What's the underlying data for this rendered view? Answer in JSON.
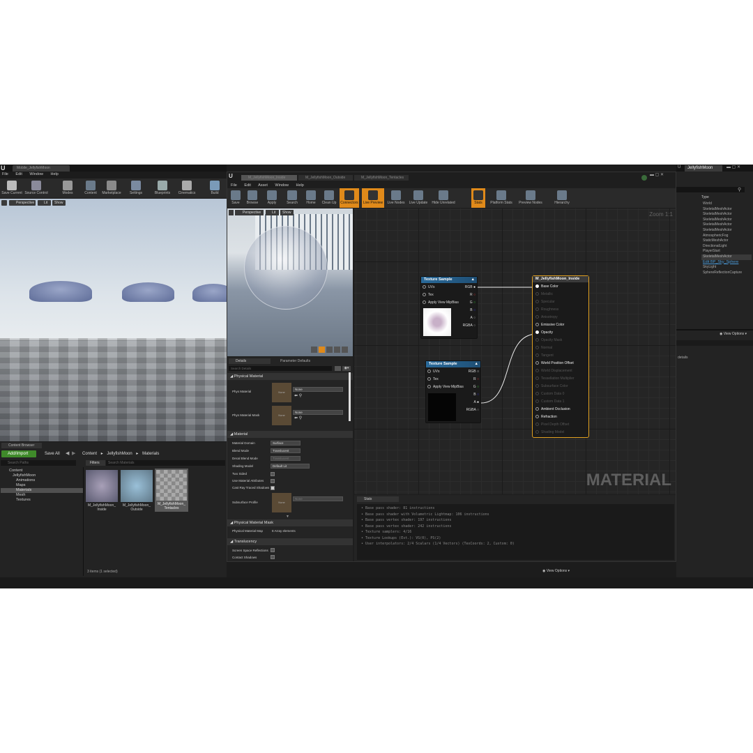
{
  "main_editor": {
    "tab_title": "Mobile_JellyfishMoon",
    "menu": [
      "File",
      "Edit",
      "Window",
      "Help"
    ],
    "toolbar": [
      "Save Current",
      "Source Control",
      "Modes",
      "Content",
      "Marketplace",
      "Settings",
      "Blueprints",
      "Cinematics",
      "Build"
    ],
    "viewport": {
      "perspective": "Perspective",
      "lit": "Lit",
      "show": "Show"
    }
  },
  "content_browser": {
    "tab": "Content Browser",
    "add_import": "Add/Import",
    "save_all": "Save All",
    "breadcrumb": [
      "Content",
      "JellyfishMoon",
      "Materials"
    ],
    "search_paths": "Search Paths",
    "filters": "Filters",
    "search_materials": "Search Materials",
    "tree": [
      {
        "label": "Content",
        "level": 0
      },
      {
        "label": "JellyfishMoon",
        "level": 1
      },
      {
        "label": "Animations",
        "level": 2
      },
      {
        "label": "Maps",
        "level": 2
      },
      {
        "label": "Materials",
        "level": 2,
        "selected": true
      },
      {
        "label": "Mesh",
        "level": 2
      },
      {
        "label": "Textures",
        "level": 2
      }
    ],
    "assets": [
      "M_JellyfishMoon_Inside",
      "M_JellyfishMoon_Outside",
      "M_JellyfishMoon_Tentacles"
    ],
    "assets_display": [
      "M_JellyfishMoon_\nInside",
      "M_JellyfishMoon_\nOutside",
      "M_JellyfishMoon_\nTentacles"
    ],
    "status": "3 items (1 selected)",
    "view_options": "View Options"
  },
  "material_editor": {
    "tabs": [
      "M_JellyfishMoon_Inside",
      "M_JellyfishMoon_Outside",
      "M_JellyfishMoon_Tentacles"
    ],
    "menu": [
      "File",
      "Edit",
      "Asset",
      "Window",
      "Help"
    ],
    "toolbar": [
      {
        "label": "Save",
        "on": false
      },
      {
        "label": "Browse",
        "on": false
      },
      {
        "label": "Apply",
        "on": false
      },
      {
        "label": "Search",
        "on": false
      },
      {
        "label": "Home",
        "on": false
      },
      {
        "label": "Clean Up",
        "on": false
      },
      {
        "label": "Connectors",
        "on": true
      },
      {
        "label": "Live Preview",
        "on": true
      },
      {
        "label": "Live Nodes",
        "on": false
      },
      {
        "label": "Live Update",
        "on": false
      },
      {
        "label": "Hide Unrelated",
        "on": false
      },
      {
        "label": "Stats",
        "on": true
      },
      {
        "label": "Platform Stats",
        "on": false
      },
      {
        "label": "Preview Nodes",
        "on": false
      },
      {
        "label": "Hierarchy",
        "on": false
      }
    ],
    "preview_viewport": {
      "perspective": "Perspective",
      "lit": "Lit",
      "show": "Show"
    },
    "details_tabs": [
      "Details",
      "Parameter Defaults"
    ],
    "search_details": "Search Details",
    "sections": {
      "physical_material": "Physical Material",
      "material": "Material",
      "physical_material_mask": "Physical Material Mask",
      "translucency": "Translucency"
    },
    "props": {
      "phys_material": "Phys Material",
      "phys_material_mask": "Phys Material Mask",
      "none": "None",
      "material_domain": "Material Domain",
      "material_domain_val": "Surface",
      "blend_mode": "Blend Mode",
      "blend_mode_val": "Translucent",
      "decal_blend_mode": "Decal Blend Mode",
      "decal_blend_mode_val": "Translucent",
      "shading_model": "Shading Model",
      "shading_model_val": "Default Lit",
      "two_sided": "Two Sided",
      "use_material_attributes": "Use Material Attributes",
      "cast_ray_traced_shadows": "Cast Ray Traced Shadows",
      "subsurface_profile": "Subsurface Profile",
      "physical_material_map": "Physical Material Map",
      "array_elements": "8 Array elements",
      "screen_space_reflections": "Screen Space Reflections",
      "contact_shadows": "Contact Shadows"
    },
    "graph": {
      "zoom": "Zoom 1:1",
      "watermark": "MATERIAL",
      "node1": {
        "title": "Texture Sample",
        "inputs": [
          "UVs",
          "Tex",
          "Apply View MipBias"
        ],
        "outputs": [
          "RGB",
          "R",
          "G",
          "B",
          "A",
          "RGBA"
        ]
      },
      "node2": {
        "title": "Texture Sample",
        "inputs": [
          "UVs",
          "Tex",
          "Apply View MipBias"
        ],
        "outputs": [
          "RGB",
          "R",
          "G",
          "B",
          "A",
          "RGBA"
        ]
      },
      "result": {
        "title": "M_JellyfishMoon_Inside",
        "pins": [
          {
            "label": "Base Color",
            "active": true
          },
          {
            "label": "Metallic",
            "active": false
          },
          {
            "label": "Specular",
            "active": false
          },
          {
            "label": "Roughness",
            "active": false
          },
          {
            "label": "Anisotropy",
            "active": false
          },
          {
            "label": "Emissive Color",
            "active": true
          },
          {
            "label": "Opacity",
            "active": true
          },
          {
            "label": "Opacity Mask",
            "active": false
          },
          {
            "label": "Normal",
            "active": false
          },
          {
            "label": "Tangent",
            "active": false
          },
          {
            "label": "World Position Offset",
            "active": true
          },
          {
            "label": "World Displacement",
            "active": false
          },
          {
            "label": "Tessellation Multiplier",
            "active": false
          },
          {
            "label": "Subsurface Color",
            "active": false
          },
          {
            "label": "Custom Data 0",
            "active": false
          },
          {
            "label": "Custom Data 1",
            "active": false
          },
          {
            "label": "Ambient Occlusion",
            "active": true
          },
          {
            "label": "Refraction",
            "active": true
          },
          {
            "label": "Pixel Depth Offset",
            "active": false
          },
          {
            "label": "Shading Model",
            "active": false
          }
        ]
      }
    },
    "stats_tab": "Stats",
    "stats": [
      "• Base pass shader: 81 instructions",
      "• Base pass shader with Volumetric Lightmap: 106 instructions",
      "• Base pass vertex shader: 197 instructions",
      "• Base pass vertex shader: 242 instructions",
      "• Texture samplers: 4/16",
      "• Texture Lookups (Est.): VS(0), PS(2)",
      "• User interpolators: 2/4 Scalars (1/4 Vectors) (TexCoords: 2, Custom: 0)"
    ]
  },
  "right_panel": {
    "tab_title": "JellyfishMoon",
    "type_header": "Type",
    "outliner": [
      "World",
      "SkeletalMeshActor",
      "SkeletalMeshActor",
      "SkeletalMeshActor",
      "SkeletalMeshActor",
      "SkeletalMeshActor",
      "AtmosphericFog",
      "StaticMeshActor",
      "DirectionalLight",
      "PlayerStart",
      "SkeletalMeshActor",
      "Edit BP_Sky_Sphere",
      "SkyLight",
      "SphereReflectionCapture"
    ],
    "view_options": "View Options",
    "details_text": "details"
  },
  "colors": {
    "accent": "#e08a1a",
    "node_header": "#2a6a9a",
    "result_border": "#e0a020",
    "selection": "#3a3a3a"
  }
}
